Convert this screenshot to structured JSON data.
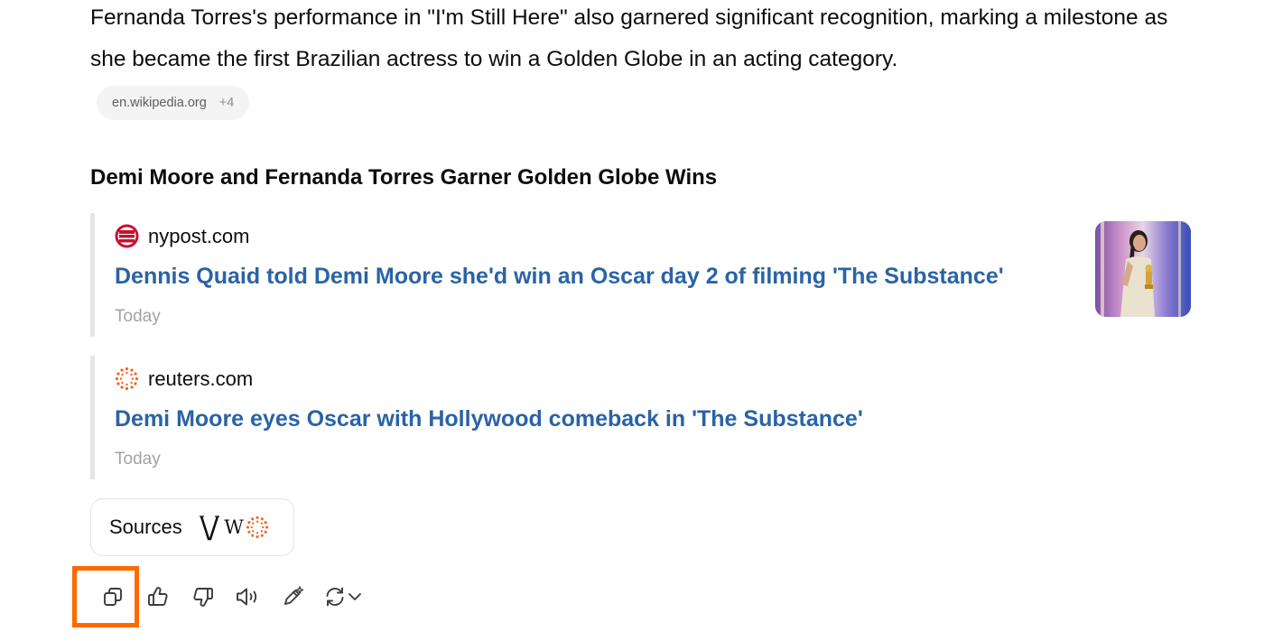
{
  "paragraph": {
    "text": "Fernanda Torres's performance in \"I'm Still Here\" also garnered significant recognition, marking a milestone as she became the first Brazilian actress to win a Golden Globe in an acting category."
  },
  "citation": {
    "domain": "en.wikipedia.org",
    "more": "+4"
  },
  "section": {
    "title": "Demi Moore and Fernanda Torres Garner Golden Globe Wins"
  },
  "news": [
    {
      "source": "nypost.com",
      "favicon": "nypost-icon",
      "headline": "Dennis Quaid told Demi Moore she'd win an Oscar day 2 of filming 'The Substance'",
      "date": "Today",
      "has_thumbnail": true
    },
    {
      "source": "reuters.com",
      "favicon": "reuters-icon",
      "headline": "Demi Moore eyes Oscar with Hollywood comeback in 'The Substance'",
      "date": "Today",
      "has_thumbnail": false
    }
  ],
  "sources_button": {
    "label": "Sources",
    "icons": [
      "vanity-fair-icon",
      "wikipedia-icon",
      "reuters-icon"
    ]
  },
  "toolbar": {
    "buttons": [
      "copy-icon",
      "thumbs-up-icon",
      "thumbs-down-icon",
      "read-aloud-icon",
      "edit-icon",
      "regenerate-icon"
    ],
    "highlighted": "copy-icon"
  },
  "colors": {
    "link": "#2a63a6",
    "highlight": "#ff6a00",
    "muted": "#a3a3a3"
  }
}
